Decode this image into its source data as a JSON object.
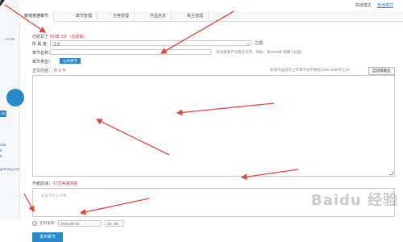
{
  "left_panel": {
    "date": "15-08-",
    "web_text": "gzhong.com",
    "numbers": [
      "205",
      "8",
      "8"
    ],
    "ad_text": "AD"
  },
  "topbar": {
    "simple_mode": "高级模式",
    "advanced_mode": "普通模式"
  },
  "tabs": [
    "新增普通章节",
    "章节管理",
    "分卷管理",
    "作品信息",
    "新主管理"
  ],
  "form": {
    "content_count_label": "已经写了",
    "content_count_text": "共0章 0字（含草稿）",
    "volume_label": "所 属 卷：",
    "volume_value": "正文",
    "after_label": "之前",
    "title_label": "章节名称：",
    "title_hint": "请注意章节号要有次序，例如：第0009章 我都小标题",
    "type_label": "章节类型：",
    "type_value": "公共章节",
    "content_label": "正文内容：",
    "content_count": "共 0 字",
    "content_note": "新增作品首次上传章节总字数在2000-3000字之间",
    "autoformat_label": "自动排版化",
    "author_label": "作者的话：",
    "author_link": "打赏答谢感谢",
    "author_placeholder": "此处不计入字数",
    "schedule_label": "定时发布",
    "schedule_date": "2016-09-24",
    "schedule_time": "19 : 00",
    "submit_label": "发布章节"
  },
  "watermark": "Baidu 经验",
  "colors": {
    "accent": "#2a89c9",
    "annotation": "#e8443a"
  }
}
